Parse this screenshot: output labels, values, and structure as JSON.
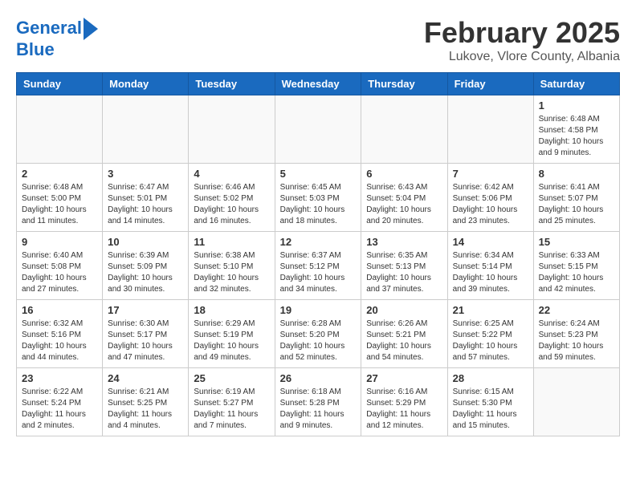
{
  "header": {
    "logo_line1": "General",
    "logo_line2": "Blue",
    "month": "February 2025",
    "location": "Lukove, Vlore County, Albania"
  },
  "days_of_week": [
    "Sunday",
    "Monday",
    "Tuesday",
    "Wednesday",
    "Thursday",
    "Friday",
    "Saturday"
  ],
  "weeks": [
    [
      {
        "day": "",
        "info": ""
      },
      {
        "day": "",
        "info": ""
      },
      {
        "day": "",
        "info": ""
      },
      {
        "day": "",
        "info": ""
      },
      {
        "day": "",
        "info": ""
      },
      {
        "day": "",
        "info": ""
      },
      {
        "day": "1",
        "info": "Sunrise: 6:48 AM\nSunset: 4:58 PM\nDaylight: 10 hours\nand 9 minutes."
      }
    ],
    [
      {
        "day": "2",
        "info": "Sunrise: 6:48 AM\nSunset: 5:00 PM\nDaylight: 10 hours\nand 11 minutes."
      },
      {
        "day": "3",
        "info": "Sunrise: 6:47 AM\nSunset: 5:01 PM\nDaylight: 10 hours\nand 14 minutes."
      },
      {
        "day": "4",
        "info": "Sunrise: 6:46 AM\nSunset: 5:02 PM\nDaylight: 10 hours\nand 16 minutes."
      },
      {
        "day": "5",
        "info": "Sunrise: 6:45 AM\nSunset: 5:03 PM\nDaylight: 10 hours\nand 18 minutes."
      },
      {
        "day": "6",
        "info": "Sunrise: 6:43 AM\nSunset: 5:04 PM\nDaylight: 10 hours\nand 20 minutes."
      },
      {
        "day": "7",
        "info": "Sunrise: 6:42 AM\nSunset: 5:06 PM\nDaylight: 10 hours\nand 23 minutes."
      },
      {
        "day": "8",
        "info": "Sunrise: 6:41 AM\nSunset: 5:07 PM\nDaylight: 10 hours\nand 25 minutes."
      }
    ],
    [
      {
        "day": "9",
        "info": "Sunrise: 6:40 AM\nSunset: 5:08 PM\nDaylight: 10 hours\nand 27 minutes."
      },
      {
        "day": "10",
        "info": "Sunrise: 6:39 AM\nSunset: 5:09 PM\nDaylight: 10 hours\nand 30 minutes."
      },
      {
        "day": "11",
        "info": "Sunrise: 6:38 AM\nSunset: 5:10 PM\nDaylight: 10 hours\nand 32 minutes."
      },
      {
        "day": "12",
        "info": "Sunrise: 6:37 AM\nSunset: 5:12 PM\nDaylight: 10 hours\nand 34 minutes."
      },
      {
        "day": "13",
        "info": "Sunrise: 6:35 AM\nSunset: 5:13 PM\nDaylight: 10 hours\nand 37 minutes."
      },
      {
        "day": "14",
        "info": "Sunrise: 6:34 AM\nSunset: 5:14 PM\nDaylight: 10 hours\nand 39 minutes."
      },
      {
        "day": "15",
        "info": "Sunrise: 6:33 AM\nSunset: 5:15 PM\nDaylight: 10 hours\nand 42 minutes."
      }
    ],
    [
      {
        "day": "16",
        "info": "Sunrise: 6:32 AM\nSunset: 5:16 PM\nDaylight: 10 hours\nand 44 minutes."
      },
      {
        "day": "17",
        "info": "Sunrise: 6:30 AM\nSunset: 5:17 PM\nDaylight: 10 hours\nand 47 minutes."
      },
      {
        "day": "18",
        "info": "Sunrise: 6:29 AM\nSunset: 5:19 PM\nDaylight: 10 hours\nand 49 minutes."
      },
      {
        "day": "19",
        "info": "Sunrise: 6:28 AM\nSunset: 5:20 PM\nDaylight: 10 hours\nand 52 minutes."
      },
      {
        "day": "20",
        "info": "Sunrise: 6:26 AM\nSunset: 5:21 PM\nDaylight: 10 hours\nand 54 minutes."
      },
      {
        "day": "21",
        "info": "Sunrise: 6:25 AM\nSunset: 5:22 PM\nDaylight: 10 hours\nand 57 minutes."
      },
      {
        "day": "22",
        "info": "Sunrise: 6:24 AM\nSunset: 5:23 PM\nDaylight: 10 hours\nand 59 minutes."
      }
    ],
    [
      {
        "day": "23",
        "info": "Sunrise: 6:22 AM\nSunset: 5:24 PM\nDaylight: 11 hours\nand 2 minutes."
      },
      {
        "day": "24",
        "info": "Sunrise: 6:21 AM\nSunset: 5:25 PM\nDaylight: 11 hours\nand 4 minutes."
      },
      {
        "day": "25",
        "info": "Sunrise: 6:19 AM\nSunset: 5:27 PM\nDaylight: 11 hours\nand 7 minutes."
      },
      {
        "day": "26",
        "info": "Sunrise: 6:18 AM\nSunset: 5:28 PM\nDaylight: 11 hours\nand 9 minutes."
      },
      {
        "day": "27",
        "info": "Sunrise: 6:16 AM\nSunset: 5:29 PM\nDaylight: 11 hours\nand 12 minutes."
      },
      {
        "day": "28",
        "info": "Sunrise: 6:15 AM\nSunset: 5:30 PM\nDaylight: 11 hours\nand 15 minutes."
      },
      {
        "day": "",
        "info": ""
      }
    ]
  ]
}
